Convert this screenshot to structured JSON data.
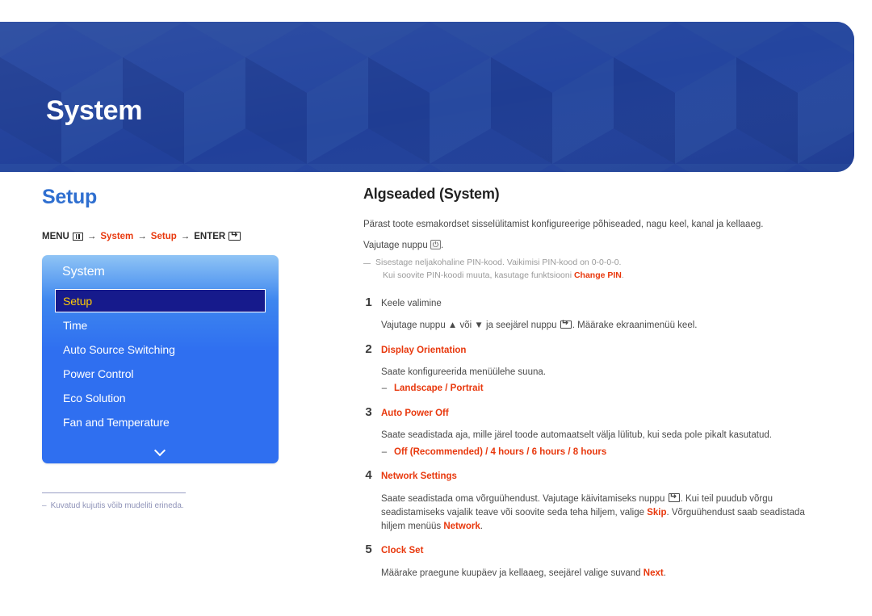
{
  "header": {
    "title": "System",
    "background_color": "#21409a",
    "pattern": "isometric-cubes"
  },
  "left": {
    "section_title": "Setup",
    "menu_path": {
      "menu_label": "MENU",
      "menu_icon": "menu-bars-icon",
      "arrow": "→",
      "step1": "System",
      "step2": "Setup",
      "enter_label": "ENTER",
      "enter_icon": "enter-key-icon"
    },
    "osd": {
      "title": "System",
      "items": [
        {
          "label": "Setup",
          "selected": true
        },
        {
          "label": "Time",
          "selected": false
        },
        {
          "label": "Auto Source Switching",
          "selected": false
        },
        {
          "label": "Power Control",
          "selected": false
        },
        {
          "label": "Eco Solution",
          "selected": false
        },
        {
          "label": "Fan and Temperature",
          "selected": false
        }
      ],
      "more_icon": "chevron-down-icon",
      "selected_text_color": "#ffcb05",
      "selected_bg_color": "#161a8c"
    },
    "footnote": {
      "dash": "–",
      "text": "Kuvatud kujutis võib mudeliti erineda."
    }
  },
  "right": {
    "title": "Algseaded (System)",
    "intro": "Pärast toote esmakordset sisselülitamist konfigureerige põhiseaded, nagu keel, kanal ja kellaaeg.",
    "press_button_prefix": "Vajutage nuppu",
    "press_button_suffix": ".",
    "power_icon": "power-button-icon",
    "pin_note_line1": "Sisestage neljakohaline PIN-kood. Vaikimisi PIN-kood on 0-0-0-0.",
    "pin_note_line2_pre": "Kui soovite PIN-koodi muuta, kasutage funktsiooni ",
    "pin_note_line2_kw": "Change PIN",
    "pin_note_line2_post": ".",
    "steps": [
      {
        "num": "1",
        "head": "Keele valimine",
        "head_red": false,
        "desc_pre": "Vajutage nuppu ▲ või ▼ ja seejärel nuppu ",
        "desc_icon": "enter-key-icon",
        "desc_post": ". Määrake ekraanimenüü keel.",
        "options": null
      },
      {
        "num": "2",
        "head": "Display Orientation",
        "head_red": true,
        "desc_pre": "Saate konfigureerida menüülehe suuna.",
        "desc_icon": null,
        "desc_post": "",
        "options": "Landscape / Portrait"
      },
      {
        "num": "3",
        "head": "Auto Power Off",
        "head_red": true,
        "desc_pre": "Saate seadistada aja, mille järel toode automaatselt välja lülitub, kui seda pole pikalt kasutatud.",
        "desc_icon": null,
        "desc_post": "",
        "options": "Off (Recommended) / 4 hours / 6 hours / 8 hours"
      },
      {
        "num": "4",
        "head": "Network Settings",
        "head_red": true,
        "desc_pre": "Saate seadistada oma võrguühendust. Vajutage käivitamiseks nuppu ",
        "desc_icon": "enter-key-icon",
        "desc_post": ". Kui teil puudub võrgu seadistamiseks vajalik teave või soovite seda teha hiljem, valige ",
        "desc_kw1": "Skip",
        "desc_mid": ". Võrguühendust saab seadistada hiljem menüüs ",
        "desc_kw2": "Network",
        "desc_end": ".",
        "options": null
      },
      {
        "num": "5",
        "head": "Clock Set",
        "head_red": true,
        "desc_pre": "Määrake praegune kuupäev ja kellaaeg, seejärel valige suvand ",
        "desc_kw1": "Next",
        "desc_end": ".",
        "desc_icon": null,
        "desc_post": "",
        "options": null
      }
    ]
  },
  "colors": {
    "brand_blue": "#21409a",
    "link_blue": "#2f6fd0",
    "accent_red": "#e8380d",
    "osd_blue": "#2f6ff0"
  }
}
